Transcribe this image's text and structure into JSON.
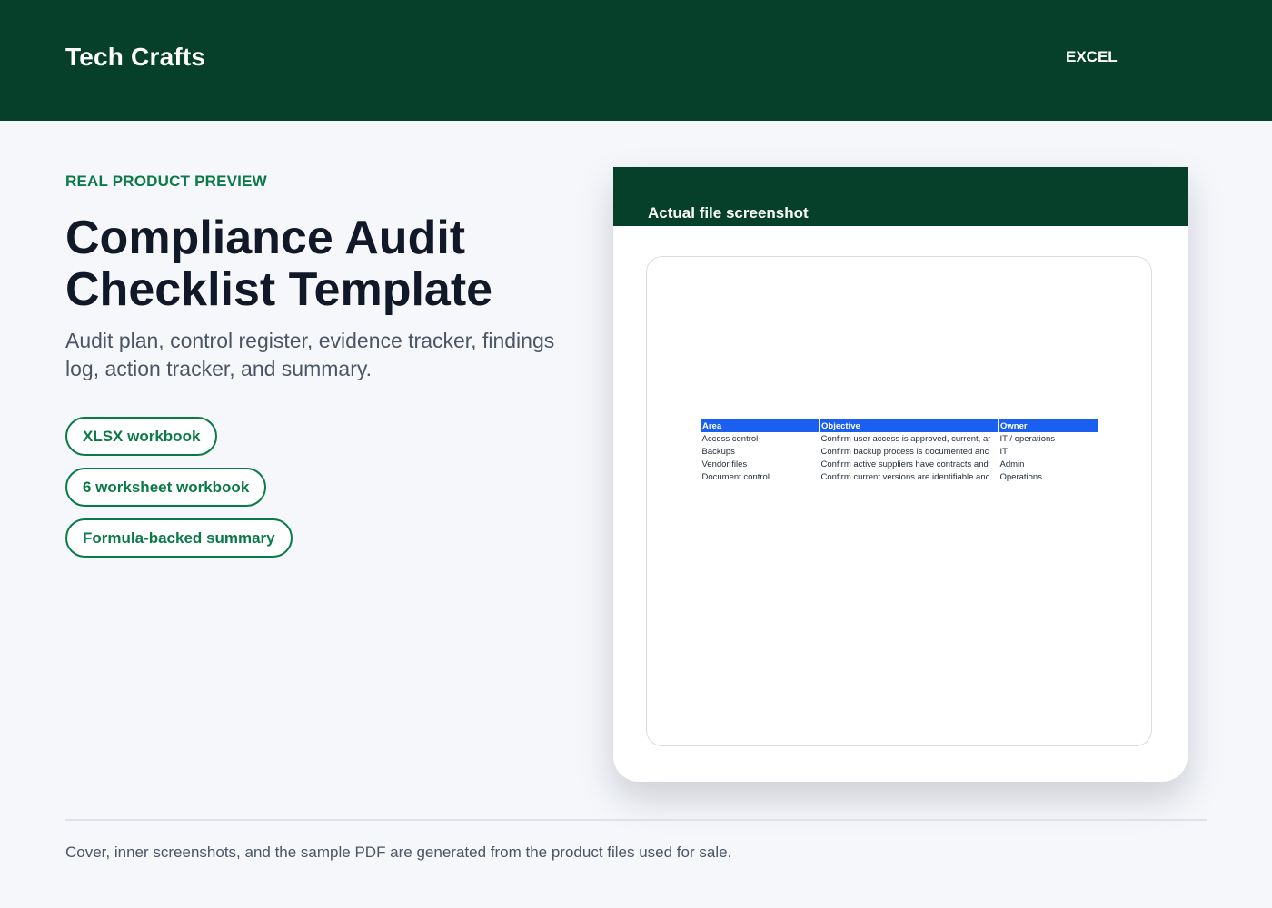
{
  "header": {
    "brand": "Tech Crafts",
    "format_tag": "EXCEL"
  },
  "hero": {
    "eyebrow": "REAL PRODUCT PREVIEW",
    "title": "Compliance Audit Checklist Template",
    "subtitle": "Audit plan, control register, evidence tracker, findings log, action tracker, and summary.",
    "pills": [
      "XLSX workbook",
      "6 worksheet workbook",
      "Formula-backed summary"
    ]
  },
  "preview": {
    "title": "Actual file screenshot",
    "sheet": {
      "columns": [
        "Area",
        "Objective",
        "Owner"
      ],
      "rows": [
        [
          "Access control",
          "Confirm user access is approved, current, ar",
          "IT / operations"
        ],
        [
          "Backups",
          "Confirm backup process is documented anc",
          "IT"
        ],
        [
          "Vendor files",
          "Confirm active suppliers have contracts and",
          "Admin"
        ],
        [
          "Document control",
          "Confirm current versions are identifiable anc",
          "Operations"
        ]
      ]
    }
  },
  "footer": {
    "note": "Cover, inner screenshots, and the sample PDF are generated from the product files used for sale."
  },
  "colors": {
    "brand_green": "#06402b",
    "accent_green": "#0a7a47",
    "sheet_header_blue": "#1a5ff0"
  }
}
